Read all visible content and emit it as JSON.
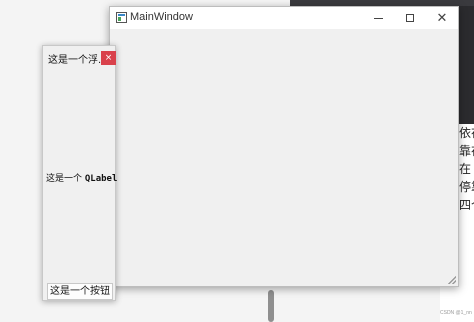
{
  "main_window": {
    "title": "MainWindow",
    "controls": {
      "minimize_icon": "minimize-icon",
      "maximize_icon": "maximize-icon",
      "close_glyph": "✕"
    }
  },
  "dock_widget": {
    "title": "这是一个浮...",
    "close_glyph": "×",
    "close_color": "#d9414b",
    "label_prefix": "这是一个 ",
    "label_mono": "QLabel",
    "button_label": "这是一个按钮"
  },
  "background": {
    "side_text": [
      "依在",
      "靠在",
      "在",
      "停靠",
      "四个"
    ],
    "watermark": "CSDN @1_nn"
  }
}
